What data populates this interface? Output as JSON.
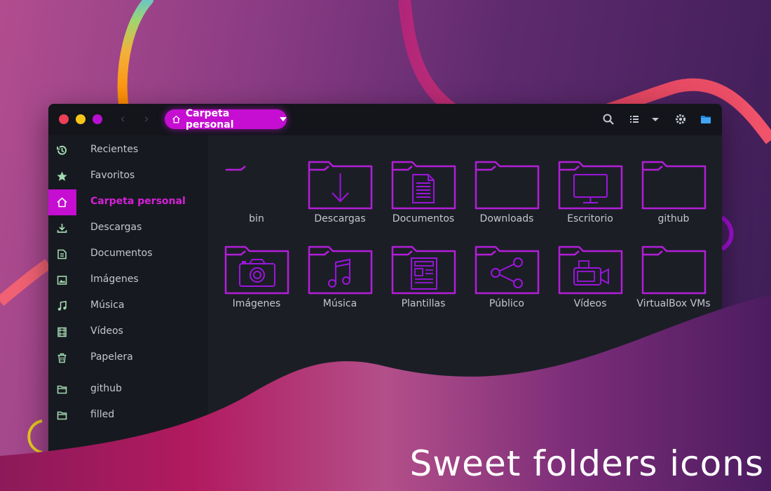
{
  "window": {
    "path_label": "Carpeta personal"
  },
  "sidebar": {
    "items": [
      {
        "label": "Recientes",
        "icon": "clock-icon"
      },
      {
        "label": "Favoritos",
        "icon": "star-icon"
      },
      {
        "label": "Carpeta personal",
        "icon": "home-icon",
        "active": true
      },
      {
        "label": "Descargas",
        "icon": "download-icon"
      },
      {
        "label": "Documentos",
        "icon": "document-icon"
      },
      {
        "label": "Imágenes",
        "icon": "image-icon"
      },
      {
        "label": "Música",
        "icon": "music-icon"
      },
      {
        "label": "Vídeos",
        "icon": "film-icon"
      },
      {
        "label": "Papelera",
        "icon": "trash-icon"
      },
      {
        "label": "github",
        "icon": "folder-icon"
      },
      {
        "label": "filled",
        "icon": "folder-icon"
      }
    ]
  },
  "folders": [
    {
      "label": "bin",
      "emblem": "none"
    },
    {
      "label": "Descargas",
      "emblem": "download"
    },
    {
      "label": "Documentos",
      "emblem": "document"
    },
    {
      "label": "Downloads",
      "emblem": "none"
    },
    {
      "label": "Escritorio",
      "emblem": "monitor"
    },
    {
      "label": "github",
      "emblem": "none"
    },
    {
      "label": "Imágenes",
      "emblem": "camera"
    },
    {
      "label": "Música",
      "emblem": "music"
    },
    {
      "label": "Plantillas",
      "emblem": "template"
    },
    {
      "label": "Público",
      "emblem": "share"
    },
    {
      "label": "Vídeos",
      "emblem": "video"
    },
    {
      "label": "VirtualBox VMs",
      "emblem": "none"
    }
  ],
  "caption": "Sweet folders icons",
  "colors": {
    "accent": "#c50ed2",
    "folder_stroke_top": "#c21ed8",
    "folder_stroke_bottom": "#8a12e0",
    "window_bg": "#1c1e26",
    "sidebar_bg": "#171920",
    "sidebar_icon": "#a3d9b1"
  }
}
